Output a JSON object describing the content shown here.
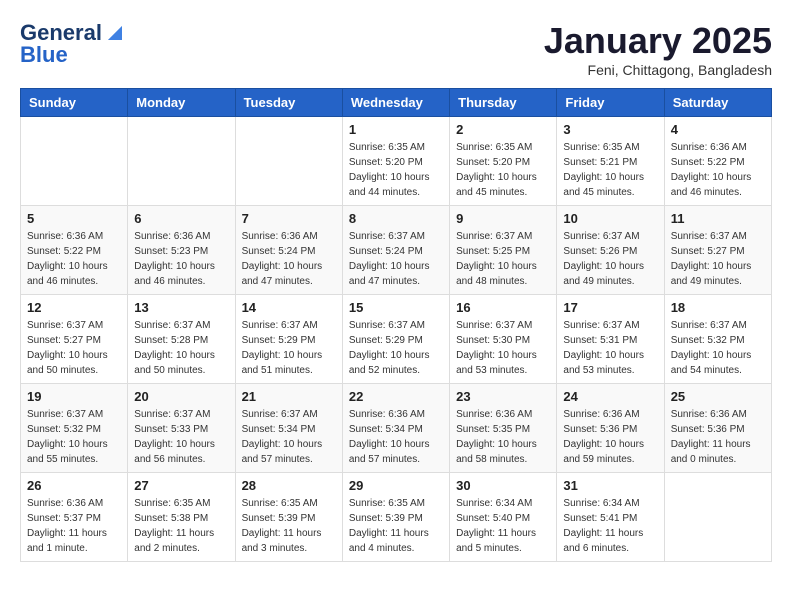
{
  "logo": {
    "text_general": "General",
    "text_blue": "Blue"
  },
  "title": "January 2025",
  "location": "Feni, Chittagong, Bangladesh",
  "days_of_week": [
    "Sunday",
    "Monday",
    "Tuesday",
    "Wednesday",
    "Thursday",
    "Friday",
    "Saturday"
  ],
  "weeks": [
    [
      {
        "day": "",
        "info": ""
      },
      {
        "day": "",
        "info": ""
      },
      {
        "day": "",
        "info": ""
      },
      {
        "day": "1",
        "info": "Sunrise: 6:35 AM\nSunset: 5:20 PM\nDaylight: 10 hours\nand 44 minutes."
      },
      {
        "day": "2",
        "info": "Sunrise: 6:35 AM\nSunset: 5:20 PM\nDaylight: 10 hours\nand 45 minutes."
      },
      {
        "day": "3",
        "info": "Sunrise: 6:35 AM\nSunset: 5:21 PM\nDaylight: 10 hours\nand 45 minutes."
      },
      {
        "day": "4",
        "info": "Sunrise: 6:36 AM\nSunset: 5:22 PM\nDaylight: 10 hours\nand 46 minutes."
      }
    ],
    [
      {
        "day": "5",
        "info": "Sunrise: 6:36 AM\nSunset: 5:22 PM\nDaylight: 10 hours\nand 46 minutes."
      },
      {
        "day": "6",
        "info": "Sunrise: 6:36 AM\nSunset: 5:23 PM\nDaylight: 10 hours\nand 46 minutes."
      },
      {
        "day": "7",
        "info": "Sunrise: 6:36 AM\nSunset: 5:24 PM\nDaylight: 10 hours\nand 47 minutes."
      },
      {
        "day": "8",
        "info": "Sunrise: 6:37 AM\nSunset: 5:24 PM\nDaylight: 10 hours\nand 47 minutes."
      },
      {
        "day": "9",
        "info": "Sunrise: 6:37 AM\nSunset: 5:25 PM\nDaylight: 10 hours\nand 48 minutes."
      },
      {
        "day": "10",
        "info": "Sunrise: 6:37 AM\nSunset: 5:26 PM\nDaylight: 10 hours\nand 49 minutes."
      },
      {
        "day": "11",
        "info": "Sunrise: 6:37 AM\nSunset: 5:27 PM\nDaylight: 10 hours\nand 49 minutes."
      }
    ],
    [
      {
        "day": "12",
        "info": "Sunrise: 6:37 AM\nSunset: 5:27 PM\nDaylight: 10 hours\nand 50 minutes."
      },
      {
        "day": "13",
        "info": "Sunrise: 6:37 AM\nSunset: 5:28 PM\nDaylight: 10 hours\nand 50 minutes."
      },
      {
        "day": "14",
        "info": "Sunrise: 6:37 AM\nSunset: 5:29 PM\nDaylight: 10 hours\nand 51 minutes."
      },
      {
        "day": "15",
        "info": "Sunrise: 6:37 AM\nSunset: 5:29 PM\nDaylight: 10 hours\nand 52 minutes."
      },
      {
        "day": "16",
        "info": "Sunrise: 6:37 AM\nSunset: 5:30 PM\nDaylight: 10 hours\nand 53 minutes."
      },
      {
        "day": "17",
        "info": "Sunrise: 6:37 AM\nSunset: 5:31 PM\nDaylight: 10 hours\nand 53 minutes."
      },
      {
        "day": "18",
        "info": "Sunrise: 6:37 AM\nSunset: 5:32 PM\nDaylight: 10 hours\nand 54 minutes."
      }
    ],
    [
      {
        "day": "19",
        "info": "Sunrise: 6:37 AM\nSunset: 5:32 PM\nDaylight: 10 hours\nand 55 minutes."
      },
      {
        "day": "20",
        "info": "Sunrise: 6:37 AM\nSunset: 5:33 PM\nDaylight: 10 hours\nand 56 minutes."
      },
      {
        "day": "21",
        "info": "Sunrise: 6:37 AM\nSunset: 5:34 PM\nDaylight: 10 hours\nand 57 minutes."
      },
      {
        "day": "22",
        "info": "Sunrise: 6:36 AM\nSunset: 5:34 PM\nDaylight: 10 hours\nand 57 minutes."
      },
      {
        "day": "23",
        "info": "Sunrise: 6:36 AM\nSunset: 5:35 PM\nDaylight: 10 hours\nand 58 minutes."
      },
      {
        "day": "24",
        "info": "Sunrise: 6:36 AM\nSunset: 5:36 PM\nDaylight: 10 hours\nand 59 minutes."
      },
      {
        "day": "25",
        "info": "Sunrise: 6:36 AM\nSunset: 5:36 PM\nDaylight: 11 hours\nand 0 minutes."
      }
    ],
    [
      {
        "day": "26",
        "info": "Sunrise: 6:36 AM\nSunset: 5:37 PM\nDaylight: 11 hours\nand 1 minute."
      },
      {
        "day": "27",
        "info": "Sunrise: 6:35 AM\nSunset: 5:38 PM\nDaylight: 11 hours\nand 2 minutes."
      },
      {
        "day": "28",
        "info": "Sunrise: 6:35 AM\nSunset: 5:39 PM\nDaylight: 11 hours\nand 3 minutes."
      },
      {
        "day": "29",
        "info": "Sunrise: 6:35 AM\nSunset: 5:39 PM\nDaylight: 11 hours\nand 4 minutes."
      },
      {
        "day": "30",
        "info": "Sunrise: 6:34 AM\nSunset: 5:40 PM\nDaylight: 11 hours\nand 5 minutes."
      },
      {
        "day": "31",
        "info": "Sunrise: 6:34 AM\nSunset: 5:41 PM\nDaylight: 11 hours\nand 6 minutes."
      },
      {
        "day": "",
        "info": ""
      }
    ]
  ]
}
